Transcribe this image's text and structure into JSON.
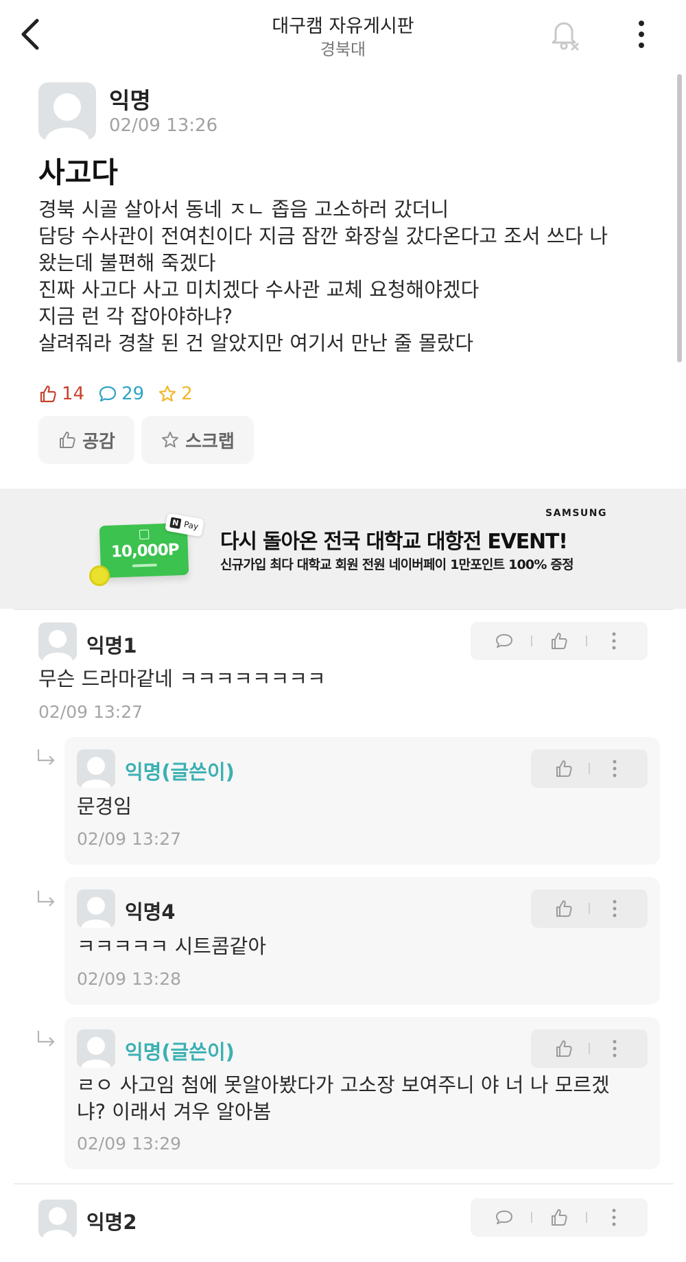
{
  "header": {
    "title": "대구캠 자유게시판",
    "subtitle": "경북대"
  },
  "post": {
    "author": "익명",
    "time": "02/09 13:26",
    "title": "사고다",
    "body_lines": [
      "경북 시골 살아서 동네 ㅈㄴ 좁음  고소하러 갔더니",
      "담당 수사관이 전여친이다 지금 잠깐 화장실 갔다온다고 조서 쓰다 나",
      "왔는데 불편해 죽겠다",
      "진짜 사고다 사고 미치겠다 수사관 교체 요청해야겠다",
      "지금 런 각 잡아야하냐?",
      "살려줘라 경찰 된 건 알았지만 여기서 만난 줄 몰랐다"
    ],
    "likes": "14",
    "comments": "29",
    "scraps": "2",
    "like_button": "공감",
    "scrap_button": "스크랩"
  },
  "ad": {
    "brand": "SAMSUNG",
    "headline": "다시 돌아온 전국 대학교 대항전 EVENT!",
    "subline": "신규가입 최다 대학교 회원 전원 네이버페이 1만포인트 100% 증정",
    "card_amount": "10,000P",
    "pay_badge_icon": "N",
    "pay_badge_text": "Pay"
  },
  "comments": [
    {
      "author": "익명1",
      "text_lines": [
        "무슨 드라마같네 ㅋㅋㅋㅋㅋㅋㅋㅋ"
      ],
      "time": "02/09 13:27"
    },
    {
      "author": "익명(글쓴이)",
      "text_lines": [
        "문경임"
      ],
      "time": "02/09 13:27"
    },
    {
      "author": "익명4",
      "text_lines": [
        "ㅋㅋㅋㅋㅋ 시트콤같아"
      ],
      "time": "02/09 13:28"
    },
    {
      "author": "익명(글쓴이)",
      "text_lines": [
        "ㄹㅇ 사고임 첨에 못알아봤다가 고소장 보여주니 야 너 나 모르겠",
        "냐? 이래서 겨우 알아봄"
      ],
      "time": "02/09 13:29"
    },
    {
      "author": "익명2",
      "text_lines": [],
      "time": ""
    }
  ],
  "colors": {
    "like": "#c8432e",
    "comment": "#2ea3c4",
    "scrap": "#f1b72a",
    "op_author": "#3cb0b3",
    "ad_green": "#3cc24f"
  }
}
